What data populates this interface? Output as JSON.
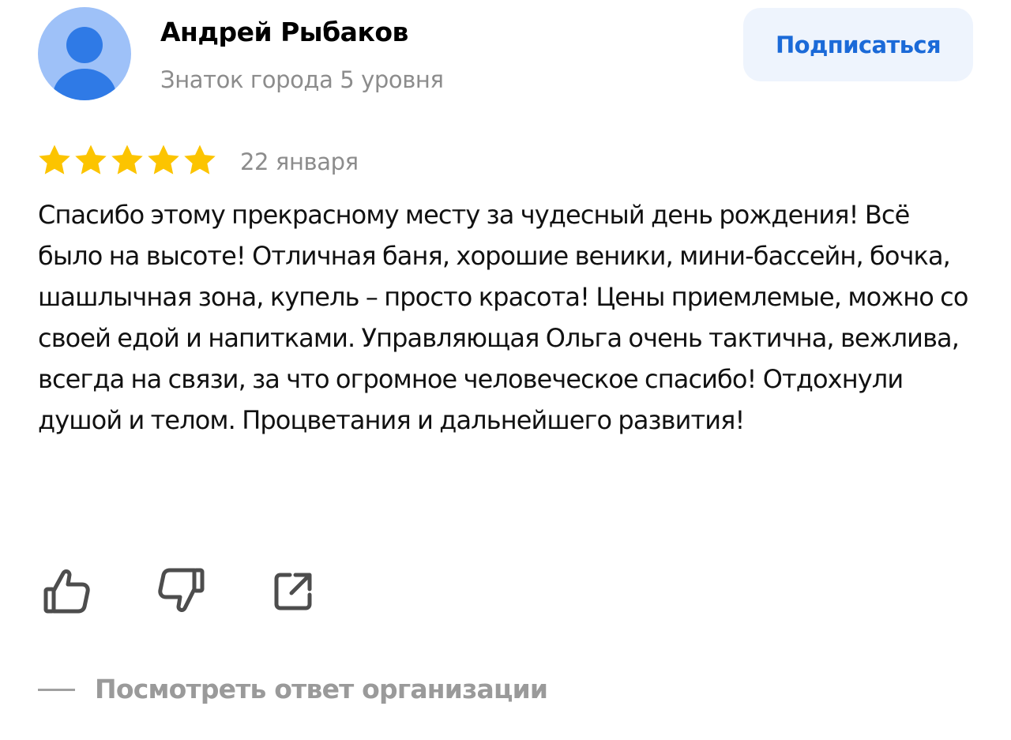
{
  "author": {
    "name": "Андрей Рыбаков",
    "level": "Знаток города 5 уровня",
    "avatar_icon": "user-placeholder-icon"
  },
  "subscribe": {
    "label": "Подписаться"
  },
  "review": {
    "rating": 5,
    "rating_max": 5,
    "date": "22 января",
    "text": "Спасибо этому прекрасному месту за чудесный день рождения! Всё было на высоте! Отличная баня, хорошие веники, мини-бассейн, бочка, шашлычная зона, купель – просто красота! Цены приемлемые, можно со своей едой и напитками. Управляющая Ольга очень тактична, вежлива, всегда на связи, за что огромное человеческое спасибо! Отдохнули душой и телом. Процветания и дальнейшего развития!"
  },
  "actions": {
    "like_icon": "thumbs-up-icon",
    "dislike_icon": "thumbs-down-icon",
    "share_icon": "share-icon"
  },
  "org_reply": {
    "label": "Посмотреть ответ организации"
  },
  "colors": {
    "accent": "#1b6ad8",
    "subscribe_bg": "#eef4fd",
    "star": "#fcc400",
    "muted_text": "#8c8c8c",
    "avatar_bg": "#9ec1f8",
    "avatar_figure": "#2f7ae6"
  }
}
